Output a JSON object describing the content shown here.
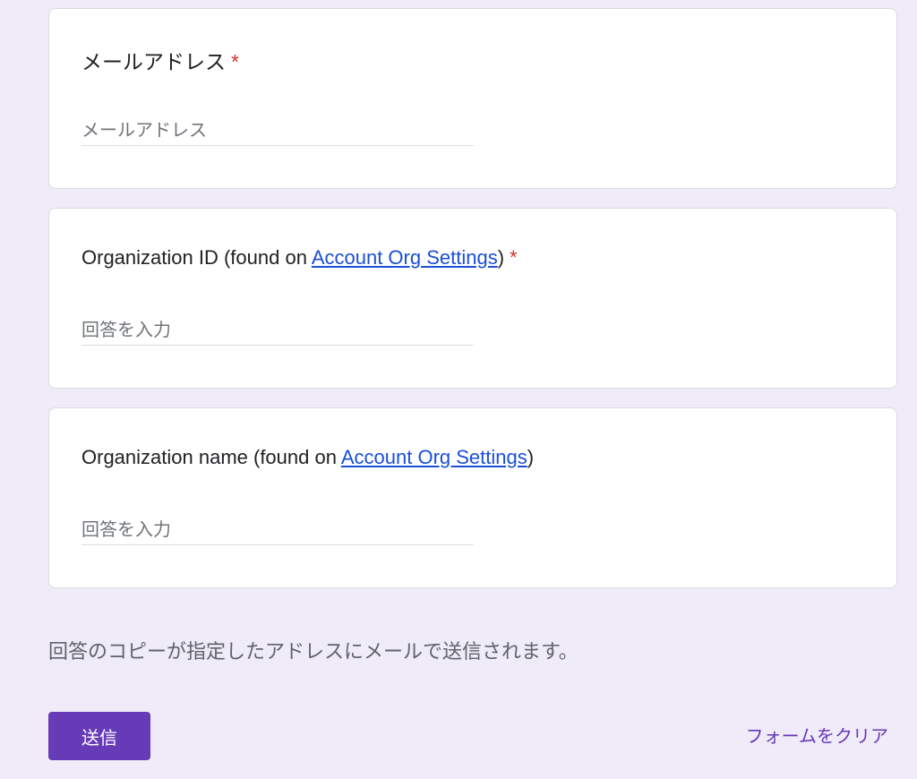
{
  "questions": [
    {
      "title": "メールアドレス",
      "required": "*",
      "placeholder": "メールアドレス"
    },
    {
      "title_prefix": "Organization ID (found on ",
      "link_text": "Account Org Settings",
      "title_suffix": ")",
      "required": "*",
      "placeholder": "回答を入力"
    },
    {
      "title_prefix": "Organization name (found on ",
      "link_text": "Account Org Settings",
      "title_suffix": ")",
      "placeholder": "回答を入力"
    }
  ],
  "footer": {
    "note": "回答のコピーが指定したアドレスにメールで送信されます。",
    "submit_label": "送信",
    "clear_label": "フォームをクリア"
  },
  "colors": {
    "accent": "#673ab7",
    "background": "#efebf8",
    "required": "#d93025",
    "link": "#1a4fd6"
  }
}
